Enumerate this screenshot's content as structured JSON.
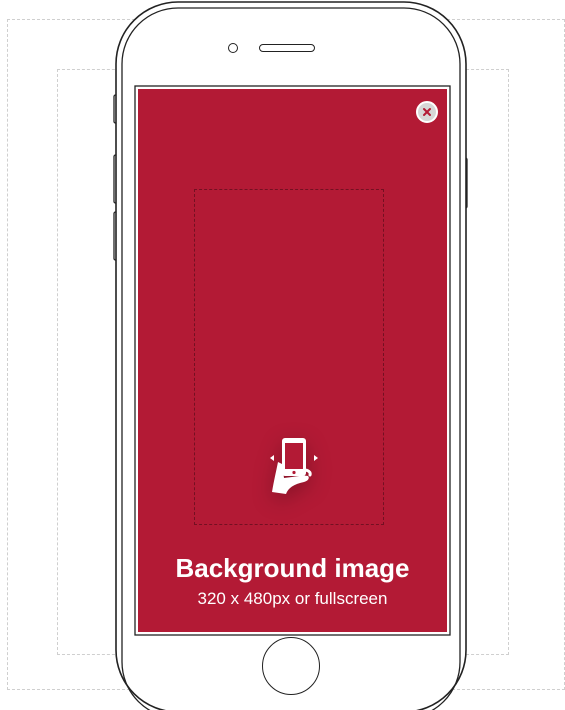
{
  "ad_preview": {
    "title": "Background image",
    "subtitle": "320 x 480px or fullscreen",
    "close_icon": "close-icon",
    "rotate_icon": "phone-rotate-hand-icon",
    "background_color": "#b31a35"
  }
}
